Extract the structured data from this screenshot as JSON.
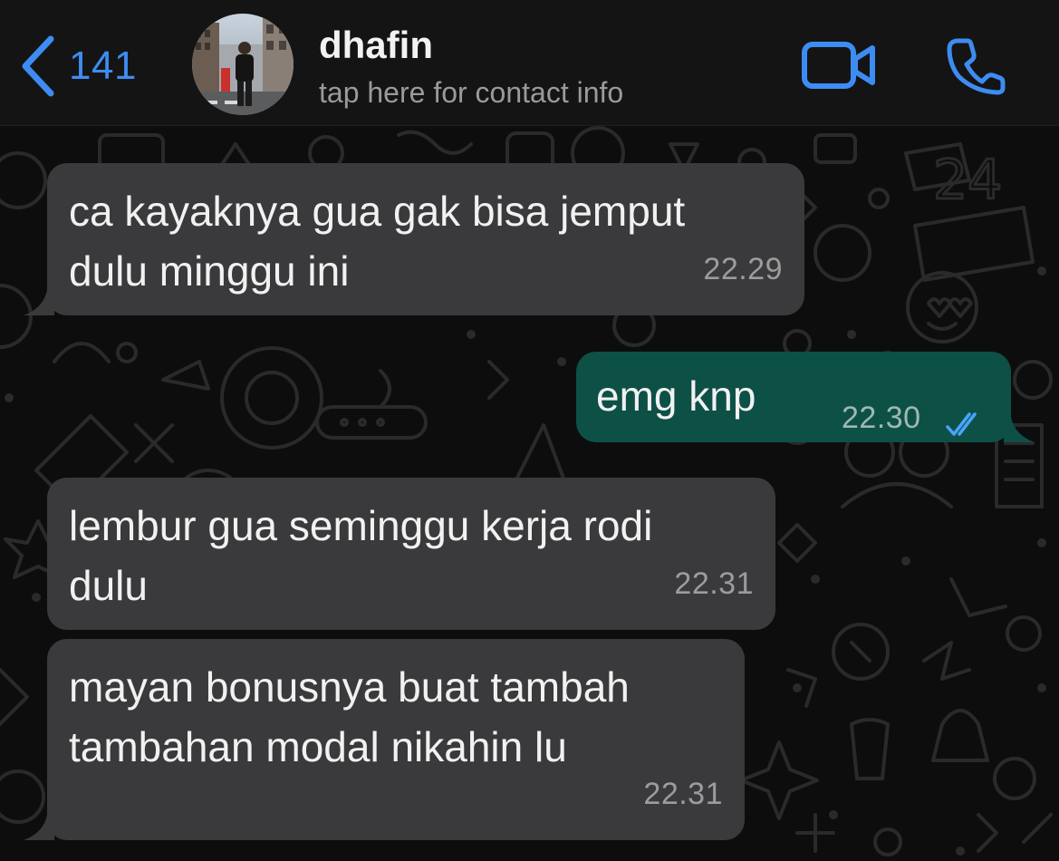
{
  "header": {
    "back_count": "141",
    "contact_name": "dhafin",
    "contact_subtitle": "tap here for contact info",
    "accent_color": "#3d8cf3",
    "icons": [
      "chevron-left-icon",
      "video-camera-icon",
      "phone-icon"
    ]
  },
  "messages": [
    {
      "direction": "incoming",
      "lines": [
        "ca kayaknya gua gak bisa jemput",
        "dulu minggu ini"
      ],
      "time": "22.29"
    },
    {
      "direction": "outgoing",
      "lines": [
        "emg knp"
      ],
      "time": "22.30",
      "status": "read"
    },
    {
      "direction": "incoming",
      "lines": [
        "lembur gua seminggu kerja rodi",
        "dulu"
      ],
      "time": "22.31"
    },
    {
      "direction": "incoming",
      "lines": [
        "mayan bonusnya buat tambah",
        "tambahan modal nikahin lu"
      ],
      "time": "22.31"
    }
  ],
  "colors": {
    "incoming_bubble": "#3a3a3c",
    "outgoing_bubble": "#0d5046",
    "read_ticks": "#4aa3ff",
    "header_bg": "#141414"
  }
}
